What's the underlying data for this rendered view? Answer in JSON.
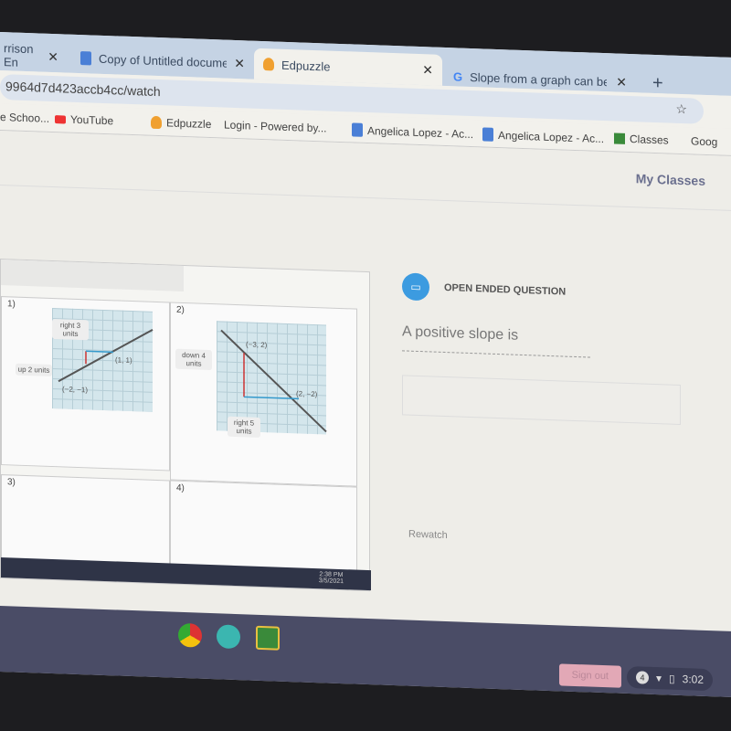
{
  "tabs": [
    {
      "label": "rrison En",
      "active": false
    },
    {
      "label": "Copy of Untitled document - (",
      "active": false
    },
    {
      "label": "Edpuzzle",
      "active": true
    },
    {
      "label": "Slope from a graph can be fo",
      "active": false
    }
  ],
  "new_tab": "+",
  "address": "9964d7d423accb4cc/watch",
  "bookmarks": [
    "e Schoo...",
    "YouTube",
    "Edpuzzle",
    "Login - Powered by...",
    "Angelica Lopez - Ac...",
    "Angelica Lopez - Ac...",
    "Classes",
    "Goog"
  ],
  "header": {
    "my_classes": "My Classes"
  },
  "video": {
    "problems": [
      {
        "num": "1)",
        "labels": [
          "right 3 units",
          "up 2 units",
          "(1, 1)",
          "(−2, −1)",
          "4",
          "2",
          "4",
          "−4",
          "O",
          "y",
          "x"
        ]
      },
      {
        "num": "2)",
        "labels": [
          "down 4 units",
          "right 5 units",
          "(−3, 2)",
          "(2, −2)",
          "4",
          "2",
          "−4",
          "−2",
          "2",
          "4",
          "O",
          "y",
          "x"
        ]
      },
      {
        "num": "3)"
      },
      {
        "num": "4)"
      }
    ],
    "taskbar_time": "2:38 PM",
    "taskbar_date": "3/5/2021"
  },
  "question": {
    "type": "OPEN ENDED QUESTION",
    "text": "A positive slope is",
    "answer_placeholder": "",
    "rewatch": "Rewatch"
  },
  "shelf": {
    "sign_out": "Sign out",
    "notifications": "4",
    "time": "3:02"
  },
  "colors": {
    "accent": "#3c9be0",
    "shelf": "#4a4c66"
  }
}
